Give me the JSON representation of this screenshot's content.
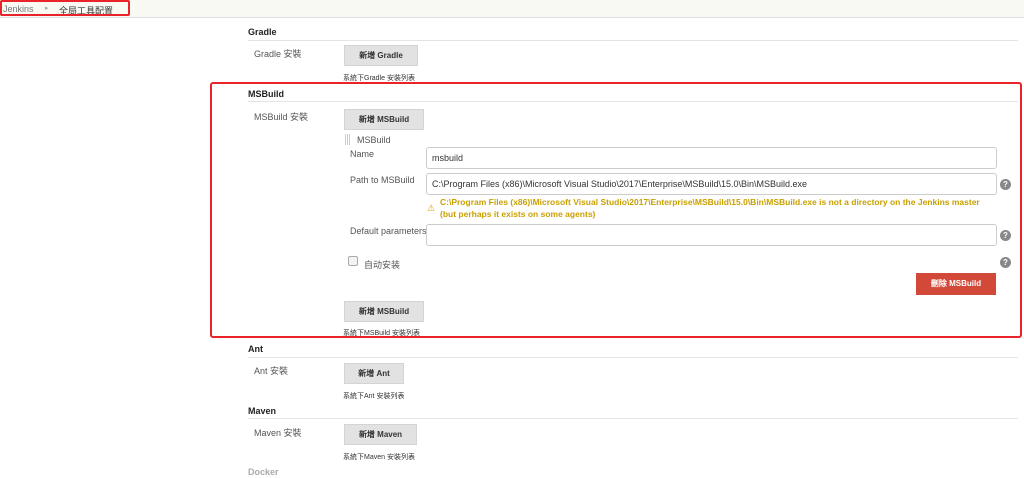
{
  "breadcrumb": {
    "root": "Jenkins",
    "current": "全局工具配置"
  },
  "gradle": {
    "heading": "Gradle",
    "label": "Gradle 安裝",
    "add_button": "新增 Gradle",
    "caption": "系統下Gradle 安裝列表"
  },
  "msbuild": {
    "heading": "MSBuild",
    "label": "MSBuild 安裝",
    "add_button": "新增 MSBuild",
    "item_title": "MSBuild",
    "name_label": "Name",
    "name_value": "msbuild",
    "path_label": "Path to MSBuild",
    "path_value": "C:\\Program Files (x86)\\Microsoft Visual Studio\\2017\\Enterprise\\MSBuild\\15.0\\Bin\\MSBuild.exe",
    "warning_line1": "C:\\Program Files (x86)\\Microsoft Visual Studio\\2017\\Enterprise\\MSBuild\\15.0\\Bin\\MSBuild.exe is not a directory on the Jenkins master",
    "warning_line2": "(but perhaps it exists on some agents)",
    "params_label": "Default parameters",
    "params_value": "",
    "auto_install_label": "自动安装",
    "delete_button": "刪除 MSBuild",
    "add_button2": "新增 MSBuild",
    "caption": "系統下MSBuild 安裝列表"
  },
  "ant": {
    "heading": "Ant",
    "label": "Ant 安裝",
    "add_button": "新增 Ant",
    "caption": "系統下Ant 安裝列表"
  },
  "maven": {
    "heading": "Maven",
    "label": "Maven 安裝",
    "add_button": "新增 Maven",
    "caption": "系統下Maven 安裝列表"
  },
  "docker": {
    "heading": "Docker"
  },
  "help_glyph": "?",
  "colors": {
    "highlight": "#e8232a",
    "warning": "#c9a000",
    "danger": "#d24939"
  }
}
